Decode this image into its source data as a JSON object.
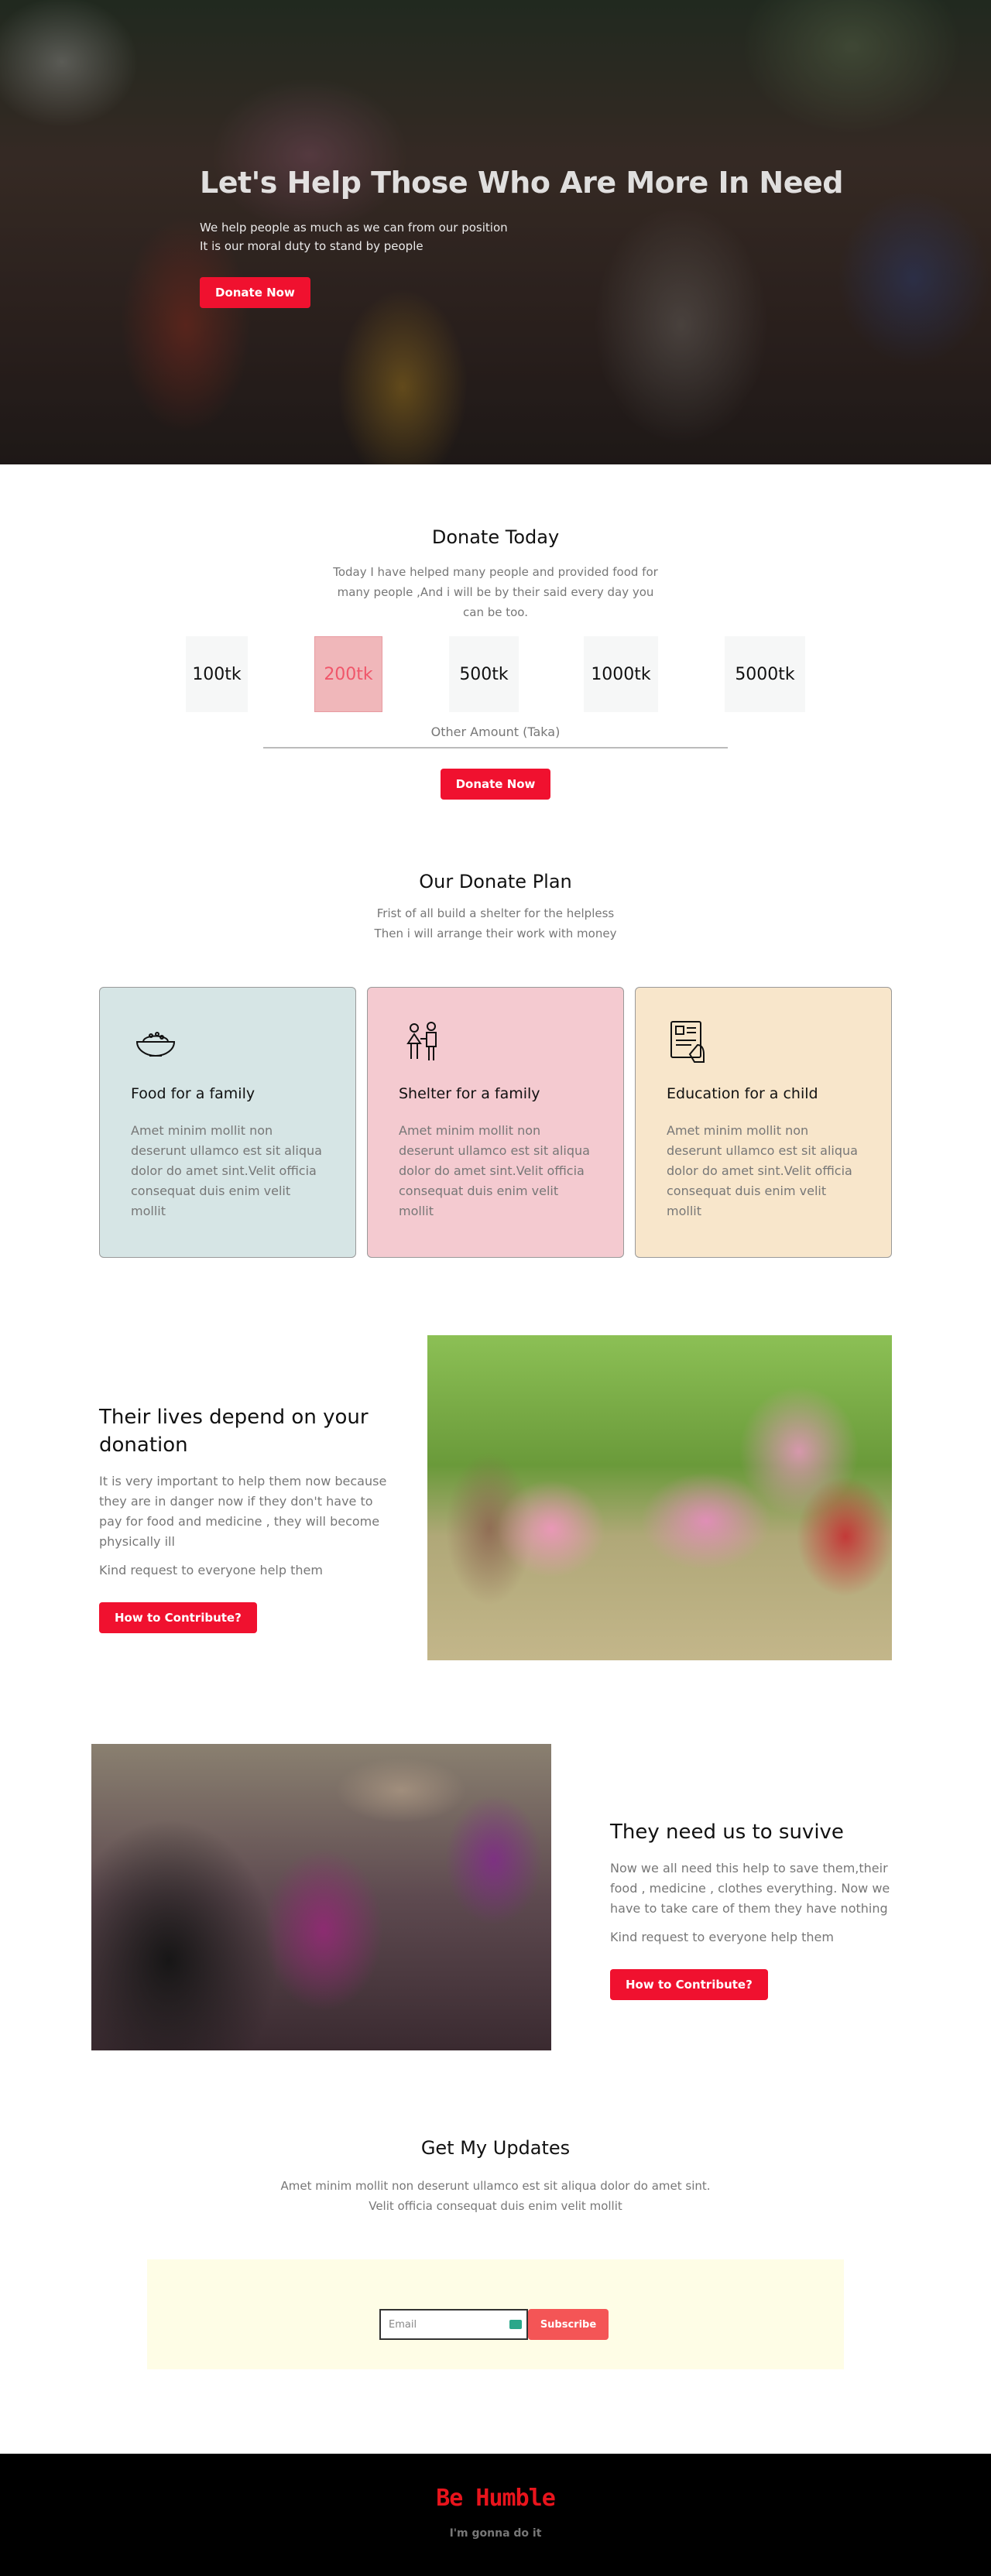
{
  "hero": {
    "title": "Let's Help Those Who Are More In Need",
    "sub_line1": "We help people as much as we can from our position",
    "sub_line2": "It is our moral duty to stand by people",
    "cta": "Donate Now"
  },
  "donate": {
    "title": "Donate Today",
    "description": "Today I have helped many people and provided food for many people ,And i will be by their said every day you can be too.",
    "amounts": [
      "100tk",
      "200tk",
      "500tk",
      "1000tk",
      "5000tk"
    ],
    "selected_index": 1,
    "other_label": "Other Amount (Taka)",
    "cta": "Donate Now"
  },
  "plan": {
    "title": "Our Donate Plan",
    "desc_line1": "Frist of all build a shelter for the helpless",
    "desc_line2": "Then i will arrange their work with money",
    "cards": [
      {
        "icon": "food-bowl-icon",
        "title": "Food for a family",
        "text": "Amet minim mollit non deserunt ullamco est sit aliqua dolor do amet sint.Velit officia consequat duis enim velit mollit",
        "color": "#d6e5e5"
      },
      {
        "icon": "family-icon",
        "title": "Shelter for a family",
        "text": "Amet minim mollit non deserunt ullamco est sit aliqua dolor do amet sint.Velit officia consequat duis enim velit mollit",
        "color": "#f4cad0"
      },
      {
        "icon": "education-icon",
        "title": "Education for a child",
        "text": "Amet minim mollit non deserunt ullamco est sit aliqua dolor do amet sint.Velit officia consequat duis enim velit mollit",
        "color": "#f8e6cb"
      }
    ]
  },
  "feature1": {
    "title": "Their lives depend on your donation",
    "text": "It is very important to help them now because they are in danger now if they don't have to pay for food and medicine , they will become physically ill",
    "note": "Kind request to everyone help them",
    "cta": "How to Contribute?"
  },
  "feature2": {
    "title": "They need us to suvive",
    "text": "Now we all need this help to save them,their food , medicine , clothes everything. Now we have to take care of them they have nothing",
    "note": "Kind request to everyone help them",
    "cta": "How to Contribute?"
  },
  "updates": {
    "title": "Get My Updates",
    "desc_line1": "Amet minim mollit non deserunt ullamco est sit aliqua dolor do amet sint.",
    "desc_line2": "Velit officia consequat duis enim velit mollit",
    "email_placeholder": "Email",
    "subscribe": "Subscribe"
  },
  "footer": {
    "logo": "Be Humble",
    "tagline": "I'm gonna do it"
  },
  "colors": {
    "accent": "#f0112f",
    "subscribe": "#f45556",
    "card_food": "#d6e5e5",
    "card_shelter": "#f4cad0",
    "card_education": "#f8e6cb"
  }
}
